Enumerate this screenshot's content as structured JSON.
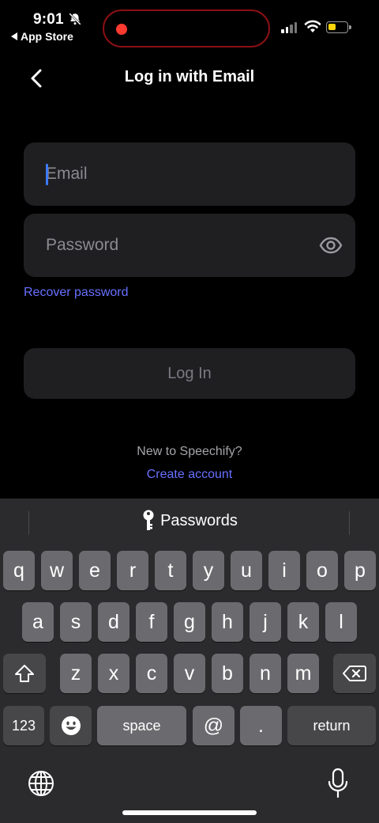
{
  "status_bar": {
    "time": "9:01",
    "back_app": "App Store",
    "recording_color": "#ff3b30",
    "battery_color": "#ffd60a"
  },
  "header": {
    "title": "Log in with Email"
  },
  "form": {
    "email_placeholder": "Email",
    "password_placeholder": "Password",
    "recover_label": "Recover password",
    "login_label": "Log In",
    "new_prompt": "New to Speechify?",
    "create_label": "Create account",
    "link_color": "#6770ff"
  },
  "keyboard": {
    "suggestion": "Passwords",
    "row1": [
      "q",
      "w",
      "e",
      "r",
      "t",
      "y",
      "u",
      "i",
      "o",
      "p"
    ],
    "row2": [
      "a",
      "s",
      "d",
      "f",
      "g",
      "h",
      "j",
      "k",
      "l"
    ],
    "row3": [
      "z",
      "x",
      "c",
      "v",
      "b",
      "n",
      "m"
    ],
    "numbers_label": "123",
    "space_label": "space",
    "at_label": "@",
    "dot_label": ".",
    "return_label": "return"
  }
}
